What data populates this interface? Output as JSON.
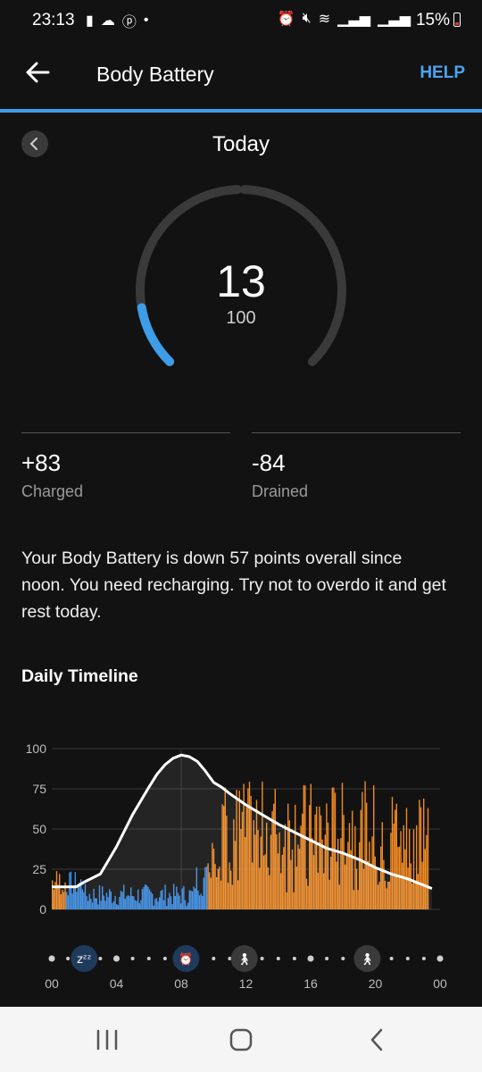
{
  "status_bar": {
    "time": "23:13",
    "battery_percent": "15%"
  },
  "app_bar": {
    "title": "Body Battery",
    "help_label": "HELP"
  },
  "day": {
    "title": "Today"
  },
  "gauge": {
    "value": "13",
    "max": "100",
    "level": 13
  },
  "stats": {
    "charged_value": "+83",
    "charged_label": "Charged",
    "drained_value": "-84",
    "drained_label": "Drained"
  },
  "description": "Your Body Battery is down 57 points overall since noon. You need recharging. Try not to overdo it and get rest today.",
  "timeline": {
    "title": "Daily Timeline"
  },
  "chart_data": {
    "type": "line",
    "y_ticks": [
      "100",
      "75",
      "50",
      "25",
      "0"
    ],
    "x_ticks": [
      "00",
      "04",
      "08",
      "12",
      "16",
      "20",
      "00"
    ],
    "ylim": [
      0,
      100
    ],
    "xlim": [
      0,
      24
    ],
    "grid": true,
    "series": [
      {
        "type": "line",
        "x": [
          0,
          0.5,
          1,
          1.5,
          2,
          3,
          4,
          5,
          6,
          6.5,
          7,
          7.5,
          8,
          8.5,
          9,
          9.5,
          10,
          10.5,
          11,
          12,
          13,
          14,
          15,
          16,
          17,
          18,
          19,
          20,
          21,
          22,
          23,
          23.5
        ],
        "y": [
          14,
          14,
          14,
          14,
          17,
          22,
          39,
          59,
          76,
          84,
          90,
          94,
          96,
          95,
          92,
          86,
          79,
          76,
          72,
          65,
          59,
          53,
          48,
          43,
          38,
          35,
          31,
          26,
          22,
          19,
          15,
          13
        ]
      }
    ],
    "stress_color": "#f08a24",
    "rest_color": "#3a8ee6",
    "line_color": "#ffffff",
    "events": [
      {
        "name": "sleep-icon",
        "hour": 2
      },
      {
        "name": "alarm-icon",
        "hour": 8.3
      },
      {
        "name": "walk-icon",
        "hour": 11.9
      },
      {
        "name": "walk-icon",
        "hour": 19.5
      }
    ]
  }
}
